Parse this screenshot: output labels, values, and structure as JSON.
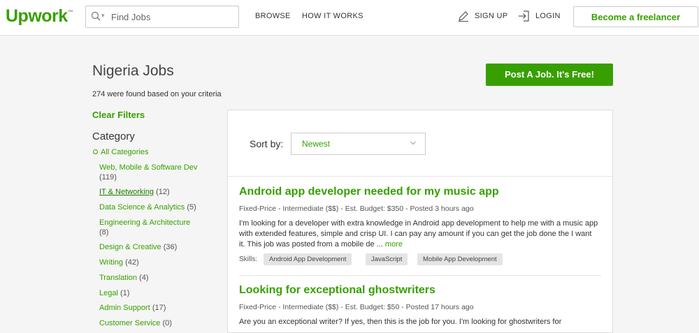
{
  "header": {
    "logo": "Upwork",
    "search_placeholder": "Find Jobs",
    "nav": {
      "browse": "BROWSE",
      "how_it_works": "HOW IT WORKS",
      "sign_up": "SIGN UP",
      "login": "LOGIN"
    },
    "freelancer_button": "Become a freelancer"
  },
  "page": {
    "title": "Nigeria Jobs",
    "result_count": "274 were found based on your criteria",
    "post_button": "Post A Job. It's Free!"
  },
  "sidebar": {
    "clear_filters": "Clear Filters",
    "category_title": "Category",
    "all_categories": "All Categories",
    "items": [
      {
        "name": "Web, Mobile & Software Dev",
        "count": "(119)"
      },
      {
        "name": "IT & Networking",
        "count": "(12)"
      },
      {
        "name": "Data Science & Analytics",
        "count": "(5)"
      },
      {
        "name": "Engineering & Architecture",
        "count": "(8)"
      },
      {
        "name": "Design & Creative",
        "count": "(36)"
      },
      {
        "name": "Writing",
        "count": "(42)"
      },
      {
        "name": "Translation",
        "count": "(4)"
      },
      {
        "name": "Legal",
        "count": "(1)"
      },
      {
        "name": "Admin Support",
        "count": "(17)"
      },
      {
        "name": "Customer Service",
        "count": "(0)"
      }
    ]
  },
  "sort": {
    "label": "Sort by:",
    "value": "Newest"
  },
  "jobs": [
    {
      "title": "Android app developer needed for my music app",
      "meta": "Fixed-Price - Intermediate ($$) - Est. Budget: $350 - Posted 3 hours ago",
      "desc": "I'm looking for a developer with extra knowledge in Android app development to help me with a music app with extended features, simple and crisp UI. I can pay any amount if you can get the job done the I want it. This job was posted from a mobile de ...",
      "more": "more",
      "skills_label": "Skills:",
      "skills": [
        "Android App Development",
        "JavaScript",
        "Mobile App Development"
      ]
    },
    {
      "title": "Looking for exceptional ghostwriters",
      "meta": "Fixed-Price - Intermediate ($$) - Est. Budget: $50 - Posted 17 hours ago",
      "desc": "Are you an exceptional writer? If yes, then this is the job for you. I'm looking for ghostwriters for"
    }
  ],
  "colors": {
    "brand": "#37a000",
    "background": "#f5f5f5"
  }
}
